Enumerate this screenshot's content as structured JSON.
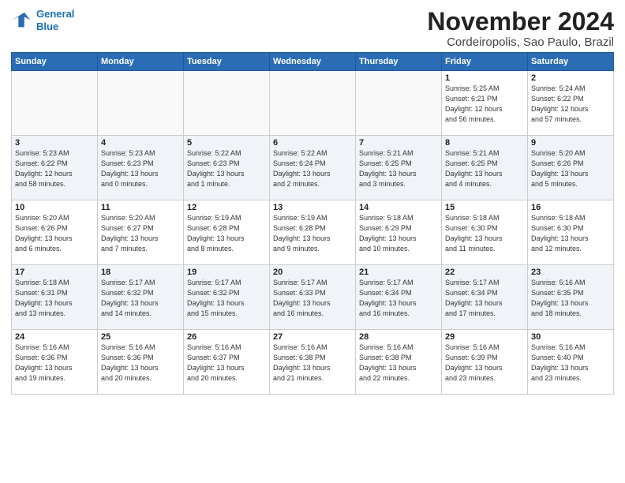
{
  "header": {
    "logo_line1": "General",
    "logo_line2": "Blue",
    "title": "November 2024",
    "subtitle": "Cordeiropolis, Sao Paulo, Brazil"
  },
  "days_of_week": [
    "Sunday",
    "Monday",
    "Tuesday",
    "Wednesday",
    "Thursday",
    "Friday",
    "Saturday"
  ],
  "weeks": [
    [
      {
        "day": "",
        "info": ""
      },
      {
        "day": "",
        "info": ""
      },
      {
        "day": "",
        "info": ""
      },
      {
        "day": "",
        "info": ""
      },
      {
        "day": "",
        "info": ""
      },
      {
        "day": "1",
        "info": "Sunrise: 5:25 AM\nSunset: 6:21 PM\nDaylight: 12 hours\nand 56 minutes."
      },
      {
        "day": "2",
        "info": "Sunrise: 5:24 AM\nSunset: 6:22 PM\nDaylight: 12 hours\nand 57 minutes."
      }
    ],
    [
      {
        "day": "3",
        "info": "Sunrise: 5:23 AM\nSunset: 6:22 PM\nDaylight: 12 hours\nand 58 minutes."
      },
      {
        "day": "4",
        "info": "Sunrise: 5:23 AM\nSunset: 6:23 PM\nDaylight: 13 hours\nand 0 minutes."
      },
      {
        "day": "5",
        "info": "Sunrise: 5:22 AM\nSunset: 6:23 PM\nDaylight: 13 hours\nand 1 minute."
      },
      {
        "day": "6",
        "info": "Sunrise: 5:22 AM\nSunset: 6:24 PM\nDaylight: 13 hours\nand 2 minutes."
      },
      {
        "day": "7",
        "info": "Sunrise: 5:21 AM\nSunset: 6:25 PM\nDaylight: 13 hours\nand 3 minutes."
      },
      {
        "day": "8",
        "info": "Sunrise: 5:21 AM\nSunset: 6:25 PM\nDaylight: 13 hours\nand 4 minutes."
      },
      {
        "day": "9",
        "info": "Sunrise: 5:20 AM\nSunset: 6:26 PM\nDaylight: 13 hours\nand 5 minutes."
      }
    ],
    [
      {
        "day": "10",
        "info": "Sunrise: 5:20 AM\nSunset: 6:26 PM\nDaylight: 13 hours\nand 6 minutes."
      },
      {
        "day": "11",
        "info": "Sunrise: 5:20 AM\nSunset: 6:27 PM\nDaylight: 13 hours\nand 7 minutes."
      },
      {
        "day": "12",
        "info": "Sunrise: 5:19 AM\nSunset: 6:28 PM\nDaylight: 13 hours\nand 8 minutes."
      },
      {
        "day": "13",
        "info": "Sunrise: 5:19 AM\nSunset: 6:28 PM\nDaylight: 13 hours\nand 9 minutes."
      },
      {
        "day": "14",
        "info": "Sunrise: 5:18 AM\nSunset: 6:29 PM\nDaylight: 13 hours\nand 10 minutes."
      },
      {
        "day": "15",
        "info": "Sunrise: 5:18 AM\nSunset: 6:30 PM\nDaylight: 13 hours\nand 11 minutes."
      },
      {
        "day": "16",
        "info": "Sunrise: 5:18 AM\nSunset: 6:30 PM\nDaylight: 13 hours\nand 12 minutes."
      }
    ],
    [
      {
        "day": "17",
        "info": "Sunrise: 5:18 AM\nSunset: 6:31 PM\nDaylight: 13 hours\nand 13 minutes."
      },
      {
        "day": "18",
        "info": "Sunrise: 5:17 AM\nSunset: 6:32 PM\nDaylight: 13 hours\nand 14 minutes."
      },
      {
        "day": "19",
        "info": "Sunrise: 5:17 AM\nSunset: 6:32 PM\nDaylight: 13 hours\nand 15 minutes."
      },
      {
        "day": "20",
        "info": "Sunrise: 5:17 AM\nSunset: 6:33 PM\nDaylight: 13 hours\nand 16 minutes."
      },
      {
        "day": "21",
        "info": "Sunrise: 5:17 AM\nSunset: 6:34 PM\nDaylight: 13 hours\nand 16 minutes."
      },
      {
        "day": "22",
        "info": "Sunrise: 5:17 AM\nSunset: 6:34 PM\nDaylight: 13 hours\nand 17 minutes."
      },
      {
        "day": "23",
        "info": "Sunrise: 5:16 AM\nSunset: 6:35 PM\nDaylight: 13 hours\nand 18 minutes."
      }
    ],
    [
      {
        "day": "24",
        "info": "Sunrise: 5:16 AM\nSunset: 6:36 PM\nDaylight: 13 hours\nand 19 minutes."
      },
      {
        "day": "25",
        "info": "Sunrise: 5:16 AM\nSunset: 6:36 PM\nDaylight: 13 hours\nand 20 minutes."
      },
      {
        "day": "26",
        "info": "Sunrise: 5:16 AM\nSunset: 6:37 PM\nDaylight: 13 hours\nand 20 minutes."
      },
      {
        "day": "27",
        "info": "Sunrise: 5:16 AM\nSunset: 6:38 PM\nDaylight: 13 hours\nand 21 minutes."
      },
      {
        "day": "28",
        "info": "Sunrise: 5:16 AM\nSunset: 6:38 PM\nDaylight: 13 hours\nand 22 minutes."
      },
      {
        "day": "29",
        "info": "Sunrise: 5:16 AM\nSunset: 6:39 PM\nDaylight: 13 hours\nand 23 minutes."
      },
      {
        "day": "30",
        "info": "Sunrise: 5:16 AM\nSunset: 6:40 PM\nDaylight: 13 hours\nand 23 minutes."
      }
    ]
  ]
}
